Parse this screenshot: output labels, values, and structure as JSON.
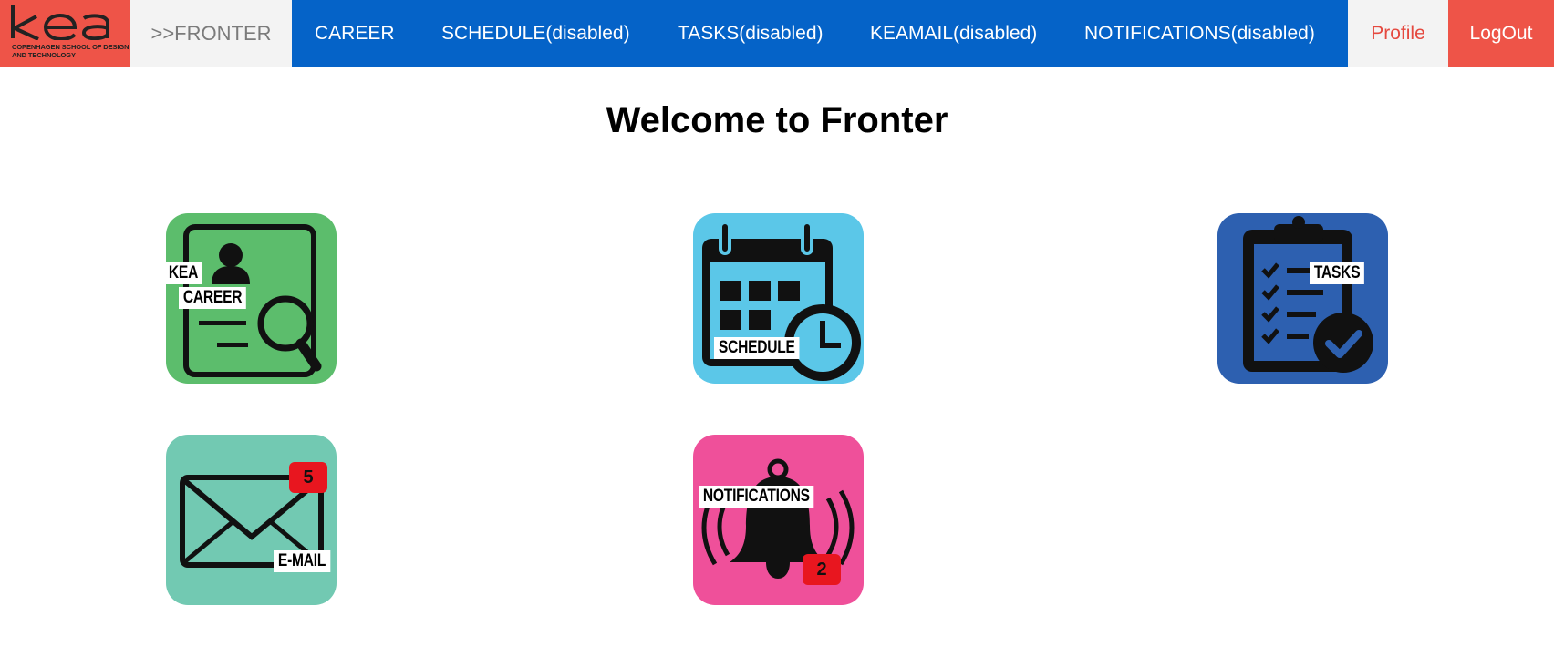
{
  "logo": {
    "word": "KEA",
    "subtitle_line1": "COPENHAGEN SCHOOL OF DESIGN",
    "subtitle_line2": "AND TECHNOLOGY"
  },
  "nav": {
    "fronter": ">>FRONTER",
    "career": "CAREER",
    "schedule": "SCHEDULE(disabled)",
    "tasks": "TASKS(disabled)",
    "keamail": "KEAMAIL(disabled)",
    "notifications": "NOTIFICATIONS(disabled)",
    "profile": "Profile",
    "logout": "LogOut"
  },
  "page": {
    "title": "Welcome to Fronter"
  },
  "tiles": {
    "career": {
      "label1": "KEA",
      "label2": "CAREER",
      "icon": "job-search-icon",
      "color": "#5cbd6c"
    },
    "schedule": {
      "label": "SCHEDULE",
      "icon": "calendar-clock-icon",
      "color": "#5bc7e8"
    },
    "tasks": {
      "label": "TASKS",
      "icon": "clipboard-check-icon",
      "color": "#2d60b0"
    },
    "email": {
      "label": "E-MAIL",
      "badge": "5",
      "icon": "envelope-icon",
      "color": "#72c9b2"
    },
    "notifications": {
      "label": "NOTIFICATIONS",
      "badge": "2",
      "icon": "bell-icon",
      "color": "#ef509a"
    }
  }
}
